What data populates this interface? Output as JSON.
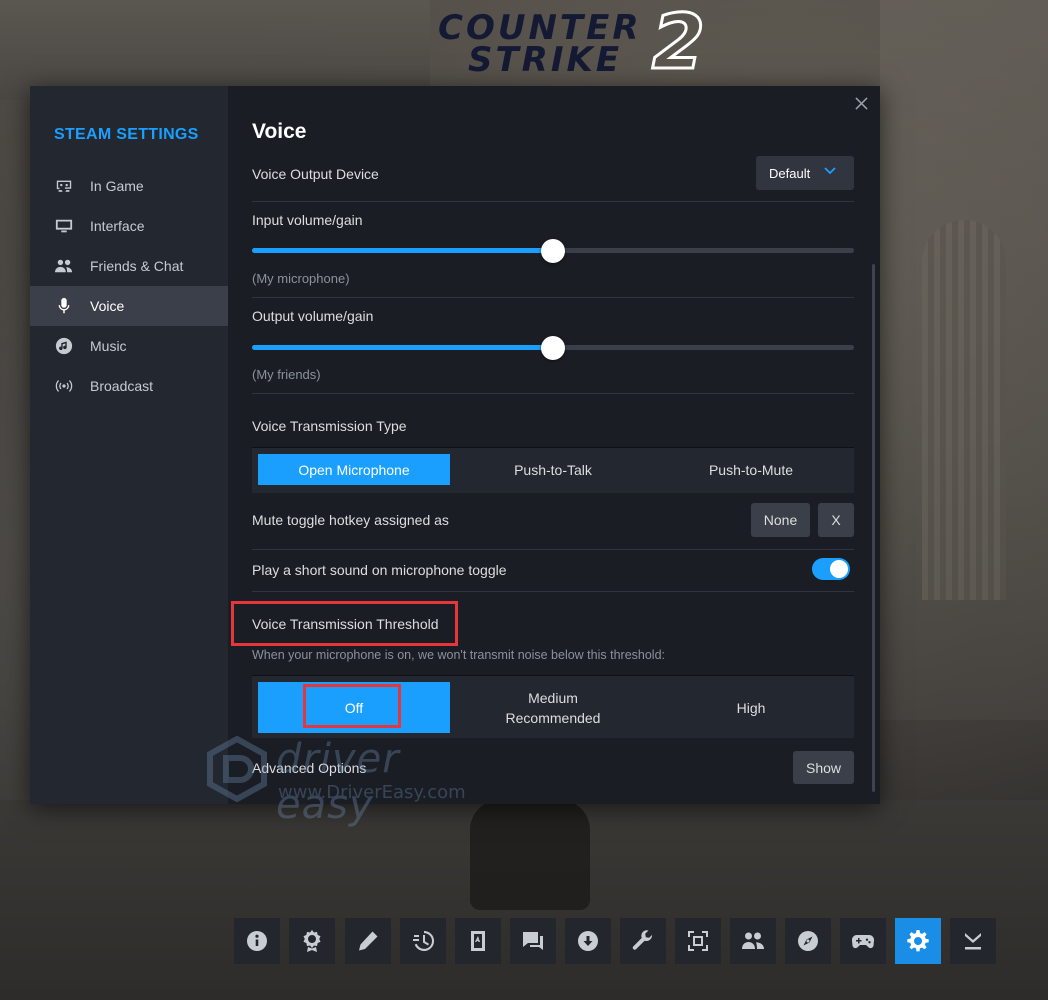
{
  "logo": {
    "line1": "COUNTER",
    "line2": "STRIKE",
    "number": "2"
  },
  "sidebar": {
    "title": "STEAM SETTINGS",
    "items": [
      {
        "label": "In Game",
        "icon": "in-game-icon",
        "active": false
      },
      {
        "label": "Interface",
        "icon": "monitor-icon",
        "active": false
      },
      {
        "label": "Friends & Chat",
        "icon": "friends-icon",
        "active": false
      },
      {
        "label": "Voice",
        "icon": "microphone-icon",
        "active": true
      },
      {
        "label": "Music",
        "icon": "music-icon",
        "active": false
      },
      {
        "label": "Broadcast",
        "icon": "broadcast-icon",
        "active": false
      }
    ]
  },
  "page": {
    "title": "Voice",
    "output_device": {
      "label": "Voice Output Device",
      "value": "Default"
    },
    "input_volume": {
      "label": "Input volume/gain",
      "sublabel": "(My microphone)",
      "value_percent": 50
    },
    "output_volume": {
      "label": "Output volume/gain",
      "sublabel": "(My friends)",
      "value_percent": 50
    },
    "transmission_type": {
      "label": "Voice Transmission Type",
      "options": [
        "Open Microphone",
        "Push-to-Talk",
        "Push-to-Mute"
      ],
      "selected": "Open Microphone"
    },
    "mute_hotkey": {
      "label": "Mute toggle hotkey assigned as",
      "value": "None",
      "clear": "X"
    },
    "toggle_sound": {
      "label": "Play a short sound on microphone toggle",
      "on": true
    },
    "threshold": {
      "label": "Voice Transmission Threshold",
      "description": "When your microphone is on, we won't transmit noise below this threshold:",
      "options": [
        {
          "line1": "Off",
          "line2": ""
        },
        {
          "line1": "Medium",
          "line2": "Recommended"
        },
        {
          "line1": "High",
          "line2": ""
        }
      ],
      "selected": "Off"
    },
    "advanced": {
      "label": "Advanced Options",
      "button": "Show"
    }
  },
  "watermark": {
    "title": "driver easy",
    "url": "www.DriverEasy.com"
  },
  "toolbar": {
    "buttons": [
      "info-icon",
      "achievements-icon",
      "notes-icon",
      "recording-icon",
      "guides-icon",
      "chat-icon",
      "downloads-icon",
      "settings-wrench-icon",
      "screenshot-icon",
      "friends-icon",
      "browser-icon",
      "controller-icon",
      "gear-icon",
      "minimize-icon"
    ],
    "active": "gear-icon"
  },
  "colors": {
    "accent": "#1a9fff",
    "highlight": "#e5363c",
    "panel": "#1a1d24",
    "sidebar": "#23272f"
  }
}
